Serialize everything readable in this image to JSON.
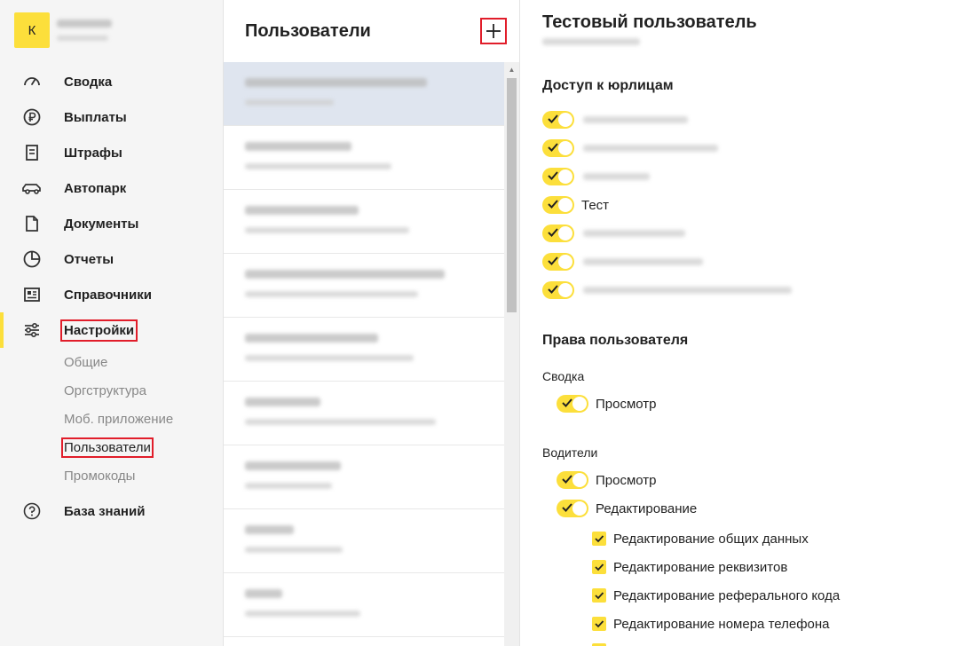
{
  "sidebar": {
    "company_initial": "К",
    "nav": [
      {
        "label": "Сводка",
        "icon": "gauge-icon"
      },
      {
        "label": "Выплаты",
        "icon": "ruble-icon"
      },
      {
        "label": "Штрафы",
        "icon": "receipt-icon"
      },
      {
        "label": "Автопарк",
        "icon": "car-icon"
      },
      {
        "label": "Документы",
        "icon": "document-icon"
      },
      {
        "label": "Отчеты",
        "icon": "pie-chart-icon"
      },
      {
        "label": "Справочники",
        "icon": "directory-icon"
      },
      {
        "label": "Настройки",
        "icon": "sliders-icon"
      }
    ],
    "settings_sub": [
      "Общие",
      "Оргструктура",
      "Моб. приложение",
      "Пользователи",
      "Промокоды"
    ],
    "help": {
      "label": "База знаний",
      "icon": "question-icon"
    }
  },
  "users": {
    "title": "Пользователи",
    "add_icon": "plus-icon"
  },
  "detail": {
    "title": "Тестовый пользователь",
    "legal_access_title": "Доступ к юрлицам",
    "legal_entities": [
      "",
      "",
      "",
      "Тест",
      "",
      "",
      ""
    ],
    "rights_title": "Права пользователя",
    "groups": {
      "summary": {
        "title": "Сводка",
        "view": "Просмотр"
      },
      "drivers": {
        "title": "Водители",
        "view": "Просмотр",
        "edit": "Редактирование",
        "options": [
          "Редактирование общих данных",
          "Редактирование реквизитов",
          "Редактирование реферального кода",
          "Редактирование номера телефона"
        ]
      }
    }
  },
  "colors": {
    "accent": "#fcdf3b",
    "highlight": "#e11d2a",
    "selected_row": "#dfe5ef"
  }
}
